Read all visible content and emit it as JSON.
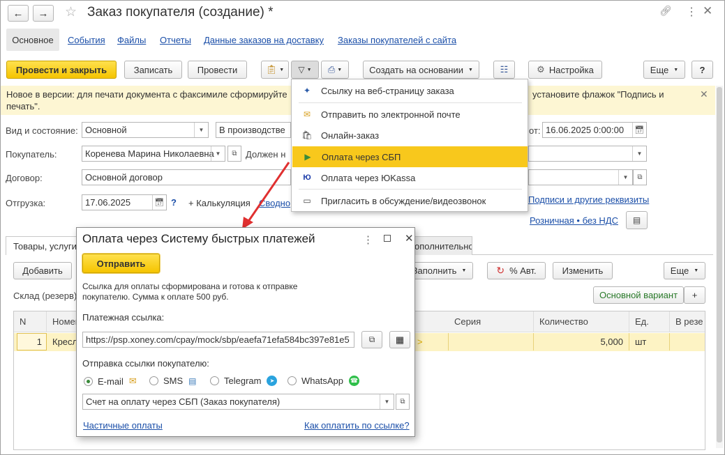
{
  "window": {
    "title": "Заказ покупателя (создание) *"
  },
  "nav_tabs": [
    "Основное",
    "События",
    "Файлы",
    "Отчеты",
    "Данные заказов на доставку",
    "Заказы покупателей с сайта"
  ],
  "toolbar": {
    "post_close": "Провести и закрыть",
    "save": "Записать",
    "post": "Провести",
    "create_based": "Создать на основании",
    "settings": "Настройка",
    "more": "Еще",
    "help": "?"
  },
  "notice": {
    "text_left": "Новое в версии: для печати документа с факсимиле сформируйте",
    "text_right": "установите флажок \"Подпись и",
    "text_line2": "печать\"."
  },
  "form": {
    "status_label": "Вид и состояние:",
    "status_kind": "Основной",
    "status_state": "В производстве",
    "date_label_tail": "от:",
    "date_value": "16.06.2025  0:00:00",
    "buyer_label": "Покупатель:",
    "buyer_value": "Коренева Марина Николаевна",
    "owes_label": "Должен н",
    "contract_label": "Договор:",
    "contract_value": "Основной договор",
    "shipment_label": "Отгрузка:",
    "shipment_value": "17.06.2025",
    "help_q": "?",
    "calc_link": "+ Калькуляция",
    "summary_link": "Сводно",
    "signatures_link": "Подписи и другие реквизиты",
    "retail_link": "Розничная • без НДС"
  },
  "send_menu": {
    "items": [
      {
        "label": "Ссылку на веб-страницу заказа",
        "icon": "web-link-icon"
      },
      {
        "label": "Отправить по электронной почте",
        "icon": "envelope-icon"
      },
      {
        "label": "Онлайн-заказ",
        "icon": "online-order-icon"
      },
      {
        "label": "Оплата через СБП",
        "icon": "sbp-icon"
      },
      {
        "label": "Оплата через ЮKassa",
        "icon": "yookassa-icon"
      },
      {
        "label": "Пригласить в обсуждение/видеозвонок",
        "icon": "video-call-icon"
      }
    ]
  },
  "lower": {
    "tab_goods": "Товары, услуги",
    "tab_extra": "ополнительно",
    "add": "Добавить",
    "fill": "Заполнить",
    "pct_auto": "% Авт.",
    "change": "Изменить",
    "more": "Еще",
    "warehouse_label": "Склад (резерв)",
    "variant": "Основной вариант",
    "plus": "+"
  },
  "table": {
    "headers": [
      "N",
      "Номен",
      "Серия",
      "Количество",
      "Ед.",
      "В резе"
    ],
    "rows": [
      {
        "n": "1",
        "name": "Кресл",
        "arrow": ">",
        "series": "",
        "qty": "5,000",
        "unit": "шт"
      }
    ]
  },
  "dialog": {
    "title": "Оплата через Систему быстрых платежей",
    "send": "Отправить",
    "info_line1": "Ссылка для оплаты сформирована и готова к отправке",
    "info_line2": "покупателю. Сумма к оплате 500 руб.",
    "link_label": "Платежная ссылка:",
    "link_value": "https://psp.xoney.com/cpay/mock/sbp/eaefa71efa584bc397e81e5",
    "send_label": "Отправка ссылки покупателю:",
    "channels": [
      {
        "label": "E-mail",
        "selected": true,
        "icon": "envelope-icon"
      },
      {
        "label": "SMS",
        "selected": false,
        "icon": "sms-icon"
      },
      {
        "label": "Telegram",
        "selected": false,
        "icon": "telegram-icon"
      },
      {
        "label": "WhatsApp",
        "selected": false,
        "icon": "whatsapp-icon"
      }
    ],
    "template_value": "Счет на оплату через СБП (Заказ покупателя)",
    "partial_link": "Частичные оплаты",
    "how_link": "Как оплатить по ссылке?"
  },
  "colors": {
    "accent_yellow": "#f5c400",
    "link_blue": "#1a4ea8",
    "arrow_red": "#e03030",
    "highlight_row": "#fdf3c4"
  }
}
